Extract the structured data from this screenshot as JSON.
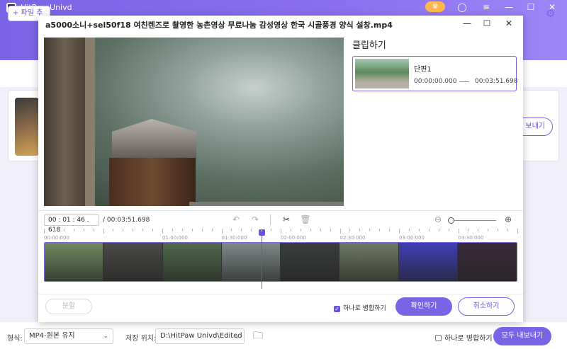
{
  "app": {
    "title": "HitPaw Univd",
    "add_file_label": "+ 파일 추",
    "export_label": "보내기"
  },
  "bottom_bar": {
    "format_label": "형식:",
    "format_value": "MP4-원본 유지",
    "save_location_label": "저장 위치:",
    "save_location_value": "D:\\HitPaw Univd\\Edited",
    "merge_label": "하나로 병합하기",
    "export_all_label": "모두 내보내기"
  },
  "dialog": {
    "title": "a5000소니+sel50f18 여친렌즈로 촬영한 농촌영상 무료나눔 감성영상 한국 시골풍경 양식 설창.mp4",
    "clip_heading": "클립하기",
    "segment": {
      "name": "단편1",
      "start": "00:00:00.000",
      "end": "00:03:51.698"
    },
    "current_time": "00 : 01 : 46 . 618",
    "total_duration": "/ 00:03:51.698",
    "playhead_fraction": 0.46,
    "ruler_ticks": [
      "00:00:000",
      "01:00:000",
      "01:30:000",
      "02:00:000",
      "02:30:000",
      "03:00:000",
      "03:30:000"
    ],
    "split_label": "분할",
    "merge_label": "하나로 병합하기",
    "confirm_label": "확인하기",
    "cancel_label": "취소하기",
    "frame_colors": [
      "#6f8a5e",
      "#4b4a48",
      "#4f6a4a",
      "#7e8a88",
      "#3a3f3c",
      "#6f7a63",
      "#3f3fb5",
      "#3a2a3a"
    ]
  }
}
